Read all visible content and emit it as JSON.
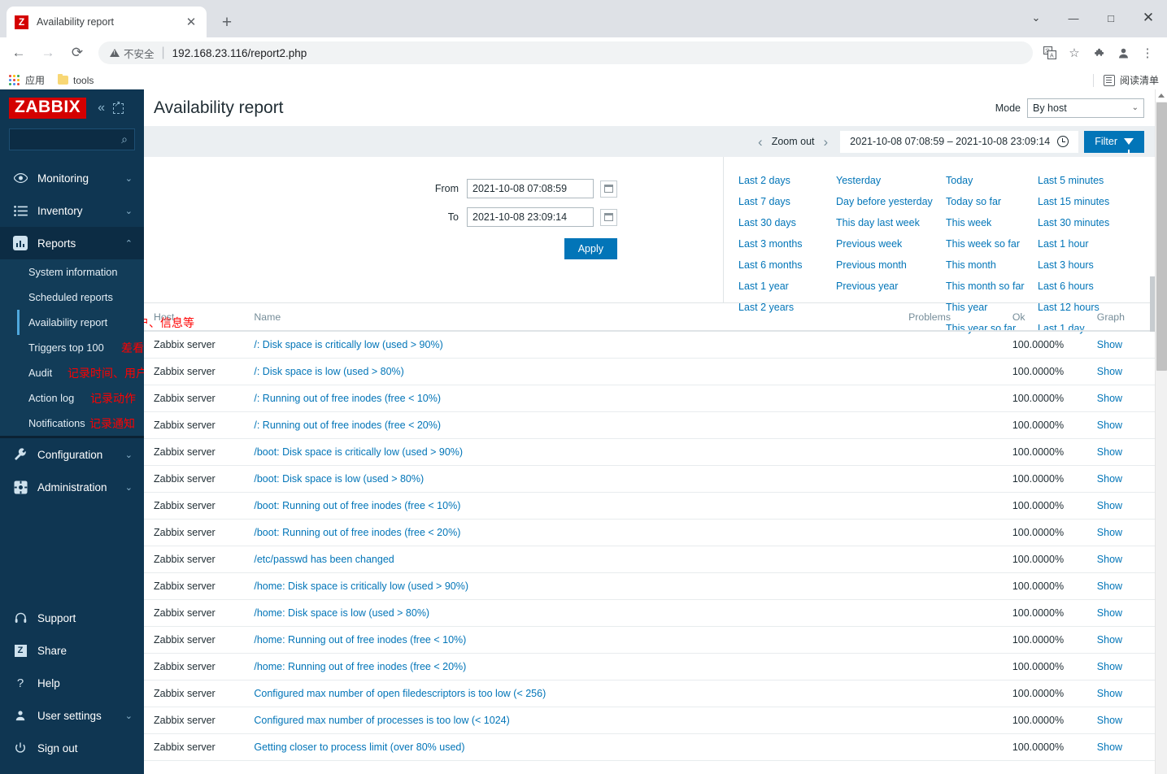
{
  "browser": {
    "tab": {
      "title": "Availability report",
      "favicon_letter": "Z",
      "close_glyph": "✕"
    },
    "new_tab_glyph": "+",
    "window_controls": {
      "minimize": "—",
      "maximize": "□",
      "close": "✕",
      "chevron": "⌄"
    },
    "nav": {
      "back": "←",
      "forward": "→",
      "reload": "⟳"
    },
    "omnibox": {
      "warning_text": "不安全",
      "separator": "|",
      "url": "192.168.23.116/report2.php"
    },
    "toolbar_icons": {
      "translate": "文A",
      "bookmark_star": "☆",
      "extensions": "🧩",
      "profile": "●",
      "menu": "⋮"
    },
    "bookmarks": {
      "apps_label": "应用",
      "tools_label": "tools",
      "reading_list": "阅读清单"
    }
  },
  "sidebar": {
    "logo": "ZABBIX",
    "collapse_glyph": "«",
    "search_placeholder": "",
    "nav": [
      {
        "label": "Monitoring",
        "icon": "eye-icon",
        "chevron": "⌄"
      },
      {
        "label": "Inventory",
        "icon": "list-icon",
        "chevron": "⌄"
      },
      {
        "label": "Reports",
        "icon": "bar-chart-icon",
        "chevron": "⌃"
      }
    ],
    "reports_submenu": [
      {
        "label": "System information",
        "note": ""
      },
      {
        "label": "Scheduled reports",
        "note": ""
      },
      {
        "label": "Availability report",
        "note": "",
        "active": true
      },
      {
        "label": "Triggers top 100",
        "note": "差看排名前一百的触发器"
      },
      {
        "label": "Audit",
        "note": "记录时间、用户、信息等"
      },
      {
        "label": "Action log",
        "note": "记录动作"
      },
      {
        "label": "Notifications",
        "note": "记录通知"
      }
    ],
    "nav_after": [
      {
        "label": "Configuration",
        "icon": "wrench-icon",
        "chevron": "⌄"
      },
      {
        "label": "Administration",
        "icon": "gear-icon",
        "chevron": "⌄"
      }
    ],
    "bottom": [
      {
        "label": "Support",
        "icon": "headset-icon",
        "chevron": ""
      },
      {
        "label": "Share",
        "icon": "zabbix-share-icon",
        "chevron": ""
      },
      {
        "label": "Help",
        "icon": "question-icon",
        "chevron": ""
      },
      {
        "label": "User settings",
        "icon": "user-icon",
        "chevron": "⌄"
      },
      {
        "label": "Sign out",
        "icon": "power-icon",
        "chevron": ""
      }
    ]
  },
  "page": {
    "title": "Availability report",
    "mode_label": "Mode",
    "mode_value": "By host"
  },
  "timebar": {
    "prev_glyph": "‹",
    "zoom_out": "Zoom out",
    "next_glyph": "›",
    "range": "2021-10-08 07:08:59 – 2021-10-08 23:09:14",
    "filter_label": "Filter"
  },
  "filter": {
    "from_label": "From",
    "from_value": "2021-10-08 07:08:59",
    "to_label": "To",
    "to_value": "2021-10-08 23:09:14",
    "apply_label": "Apply",
    "quick_columns": [
      [
        "Last 2 days",
        "Last 7 days",
        "Last 30 days",
        "Last 3 months",
        "Last 6 months",
        "Last 1 year",
        "Last 2 years"
      ],
      [
        "Yesterday",
        "Day before yesterday",
        "This day last week",
        "Previous week",
        "Previous month",
        "Previous year"
      ],
      [
        "Today",
        "Today so far",
        "This week",
        "This week so far",
        "This month",
        "This month so far",
        "This year",
        "This year so far"
      ],
      [
        "Last 5 minutes",
        "Last 15 minutes",
        "Last 30 minutes",
        "Last 1 hour",
        "Last 3 hours",
        "Last 6 hours",
        "Last 12 hours",
        "Last 1 day"
      ]
    ]
  },
  "table": {
    "headers": {
      "host": "Host",
      "name": "Name",
      "problems": "Problems",
      "ok": "Ok",
      "graph": "Graph"
    },
    "header_note": "记录时间、用户、信息等",
    "graph_link_label": "Show",
    "rows": [
      {
        "host": "Zabbix server",
        "name": "/: Disk space is critically low (used > 90%)",
        "problems": "",
        "ok": "100.0000%"
      },
      {
        "host": "Zabbix server",
        "name": "/: Disk space is low (used > 80%)",
        "problems": "",
        "ok": "100.0000%"
      },
      {
        "host": "Zabbix server",
        "name": "/: Running out of free inodes (free < 10%)",
        "problems": "",
        "ok": "100.0000%"
      },
      {
        "host": "Zabbix server",
        "name": "/: Running out of free inodes (free < 20%)",
        "problems": "",
        "ok": "100.0000%"
      },
      {
        "host": "Zabbix server",
        "name": "/boot: Disk space is critically low (used > 90%)",
        "problems": "",
        "ok": "100.0000%"
      },
      {
        "host": "Zabbix server",
        "name": "/boot: Disk space is low (used > 80%)",
        "problems": "",
        "ok": "100.0000%"
      },
      {
        "host": "Zabbix server",
        "name": "/boot: Running out of free inodes (free < 10%)",
        "problems": "",
        "ok": "100.0000%"
      },
      {
        "host": "Zabbix server",
        "name": "/boot: Running out of free inodes (free < 20%)",
        "problems": "",
        "ok": "100.0000%"
      },
      {
        "host": "Zabbix server",
        "name": "/etc/passwd has been changed",
        "problems": "",
        "ok": "100.0000%"
      },
      {
        "host": "Zabbix server",
        "name": "/home: Disk space is critically low (used > 90%)",
        "problems": "",
        "ok": "100.0000%"
      },
      {
        "host": "Zabbix server",
        "name": "/home: Disk space is low (used > 80%)",
        "problems": "",
        "ok": "100.0000%"
      },
      {
        "host": "Zabbix server",
        "name": "/home: Running out of free inodes (free < 10%)",
        "problems": "",
        "ok": "100.0000%"
      },
      {
        "host": "Zabbix server",
        "name": "/home: Running out of free inodes (free < 20%)",
        "problems": "",
        "ok": "100.0000%"
      },
      {
        "host": "Zabbix server",
        "name": "Configured max number of open filedescriptors is too low (< 256)",
        "problems": "",
        "ok": "100.0000%"
      },
      {
        "host": "Zabbix server",
        "name": "Configured max number of processes is too low (< 1024)",
        "problems": "",
        "ok": "100.0000%"
      },
      {
        "host": "Zabbix server",
        "name": "Getting closer to process limit (over 80% used)",
        "problems": "",
        "ok": "100.0000%"
      }
    ]
  },
  "colors": {
    "zabbix_red": "#d40000",
    "sidebar_bg": "#0f3652",
    "submenu_bg": "#123c58",
    "accent_blue": "#0275b8",
    "link_blue": "#0275b8",
    "ok_green": "#429e47",
    "annotation_red": "#ff0000"
  }
}
